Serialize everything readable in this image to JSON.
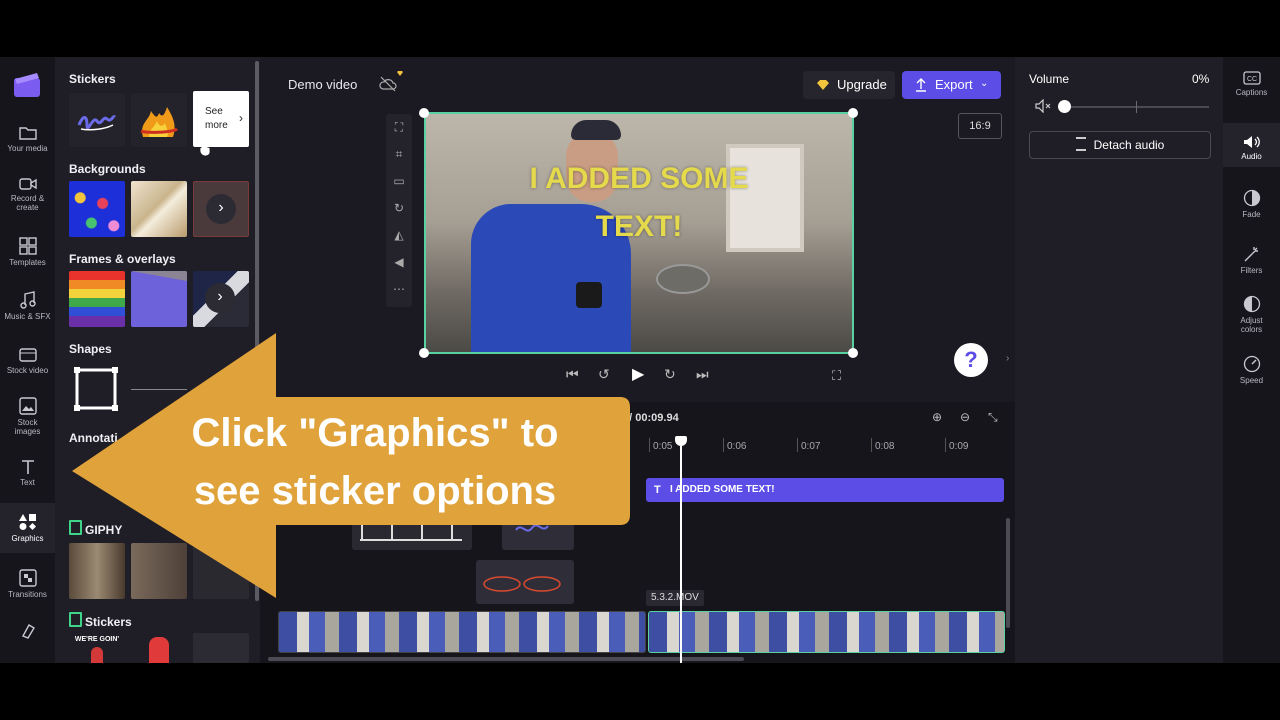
{
  "rail": {
    "items": [
      {
        "label": "Your media",
        "icon": "folder-icon"
      },
      {
        "label": "Record & create",
        "icon": "camera-icon"
      },
      {
        "label": "Templates",
        "icon": "templates-icon"
      },
      {
        "label": "Music & SFX",
        "icon": "music-icon"
      },
      {
        "label": "Stock video",
        "icon": "film-icon"
      },
      {
        "label": "Stock images",
        "icon": "image-icon"
      },
      {
        "label": "Text",
        "icon": "text-icon"
      },
      {
        "label": "Graphics",
        "icon": "graphics-icon"
      },
      {
        "label": "Transitions",
        "icon": "transitions-icon"
      },
      {
        "label": "",
        "icon": "brand-kit-icon"
      }
    ],
    "active": "Graphics"
  },
  "panel": {
    "stickers_title": "Stickers",
    "see_more_label": "See more",
    "backgrounds_title": "Backgrounds",
    "frames_title": "Frames & overlays",
    "shapes_title": "Shapes",
    "annotations_title": "Annotati",
    "giphy_title": "GIPHY",
    "giphy_stickers_title": "Stickers",
    "giphy_sticker_caption": "WE'RE GOIN'"
  },
  "stage": {
    "project_title": "Demo video",
    "upgrade_label": "Upgrade",
    "export_label": "Export",
    "aspect_ratio": "16:9",
    "overlay_line1": "I ADDED SOME",
    "overlay_line2": "TEXT!",
    "help_label": "?"
  },
  "timeline": {
    "time_display": "4 / 00:09.94",
    "ruler": [
      "0:05",
      "0:06",
      "0:07",
      "0:08",
      "0:09"
    ],
    "text_clip_label": "I ADDED SOME TEXT!",
    "video_clip_label": "5.3.2.MOV"
  },
  "audio_panel": {
    "title": "Volume",
    "volume_value": "0%",
    "volume_level": 0,
    "detach_label": "Detach audio"
  },
  "right_rail": {
    "items": [
      {
        "label": "Captions",
        "icon": "captions-icon"
      },
      {
        "label": "Audio",
        "icon": "speaker-icon"
      },
      {
        "label": "Fade",
        "icon": "fade-icon"
      },
      {
        "label": "Filters",
        "icon": "filters-icon"
      },
      {
        "label": "Adjust colors",
        "icon": "adjust-colors-icon"
      },
      {
        "label": "Speed",
        "icon": "speed-icon"
      }
    ],
    "active": "Audio"
  },
  "callout": {
    "line1": "Click \"Graphics\" to",
    "line2": "see sticker options",
    "color": "#e0a23a"
  },
  "colors": {
    "accent": "#5b4de6",
    "selection": "#5ad1a0",
    "overlay_text": "#e5d94c"
  }
}
